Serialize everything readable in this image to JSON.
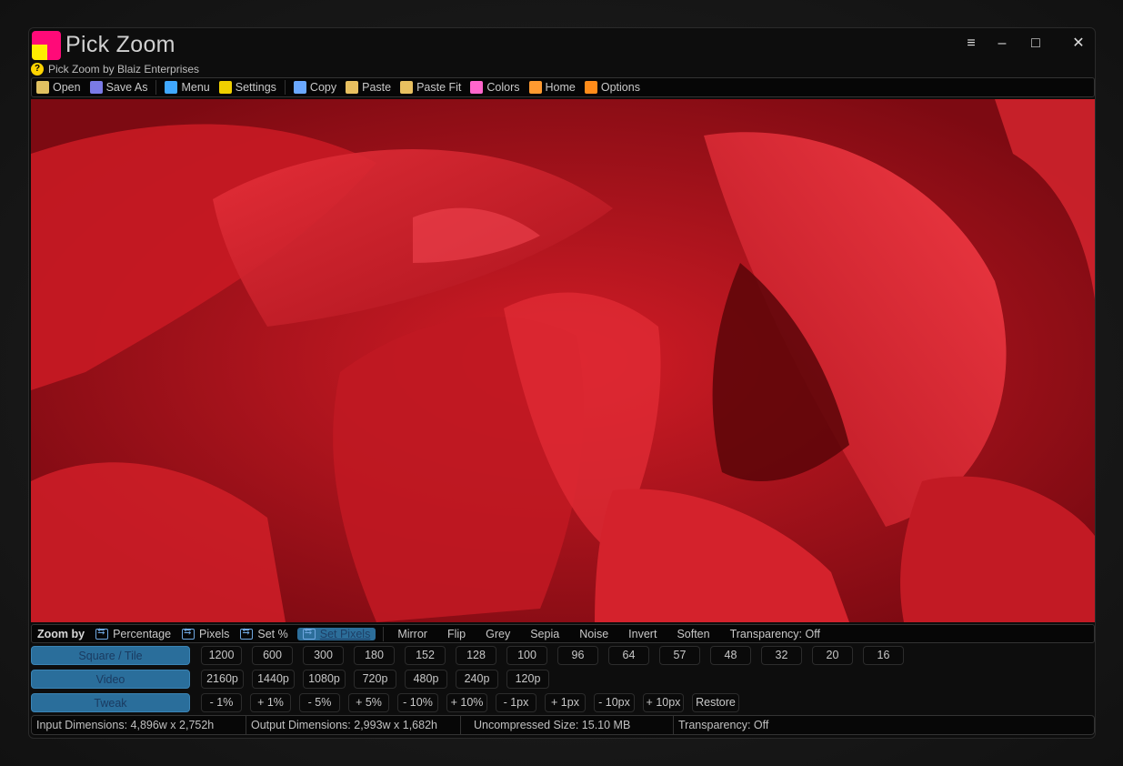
{
  "window": {
    "title": "Pick Zoom",
    "subtitle": "Pick Zoom by Blaiz Enterprises",
    "controls": [
      "≡",
      "–",
      "□",
      "✕"
    ]
  },
  "toolbar": [
    {
      "name": "open",
      "label": "Open",
      "icon": "folder-open-icon",
      "color": "#e0c060"
    },
    {
      "name": "save-as",
      "label": "Save As",
      "icon": "floppy-icon",
      "color": "#7a7ae6"
    },
    {
      "name": "menu",
      "label": "Menu",
      "icon": "menu-icon",
      "color": "#40a8ff"
    },
    {
      "name": "settings",
      "label": "Settings",
      "icon": "gear-icon",
      "color": "#f0d000"
    },
    {
      "name": "copy",
      "label": "Copy",
      "icon": "copy-icon",
      "color": "#6aa8ff"
    },
    {
      "name": "paste",
      "label": "Paste",
      "icon": "paste-icon",
      "color": "#e8c060"
    },
    {
      "name": "paste-fit",
      "label": "Paste Fit",
      "icon": "paste-fit-icon",
      "color": "#e8c060"
    },
    {
      "name": "colors",
      "label": "Colors",
      "icon": "palette-icon",
      "color": "#ff66cc"
    },
    {
      "name": "home",
      "label": "Home",
      "icon": "home-icon",
      "color": "#ff9a30"
    },
    {
      "name": "options",
      "label": "Options",
      "icon": "options-icon",
      "color": "#ff8c1a"
    }
  ],
  "zoom_by": {
    "label": "Zoom by",
    "modes": [
      {
        "label": "Percentage",
        "active": false
      },
      {
        "label": "Pixels",
        "active": false
      },
      {
        "label": "Set %",
        "active": false
      },
      {
        "label": "Set Pixels",
        "active": true
      }
    ],
    "effects": [
      "Mirror",
      "Flip",
      "Grey",
      "Sepia",
      "Noise",
      "Invert",
      "Soften",
      "Transparency: Off"
    ]
  },
  "rows": [
    {
      "name": "square-tile",
      "label": "Square / Tile",
      "buttons": [
        "1200",
        "600",
        "300",
        "180",
        "152",
        "128",
        "100",
        "96",
        "64",
        "57",
        "48",
        "32",
        "20",
        "16"
      ]
    },
    {
      "name": "video",
      "label": "Video",
      "buttons": [
        "2160p",
        "1440p",
        "1080p",
        "720p",
        "480p",
        "240p",
        "120p"
      ]
    },
    {
      "name": "tweak",
      "label": "Tweak",
      "buttons": [
        "- 1%",
        "+ 1%",
        "- 5%",
        "+ 5%",
        "- 10%",
        "+ 10%",
        "- 1px",
        "+ 1px",
        "- 10px",
        "+ 10px",
        "Restore"
      ]
    }
  ],
  "status": {
    "input": "Input Dimensions: 4,896w x 2,752h",
    "output": "Output Dimensions: 2,993w x 1,682h",
    "size": "Uncompressed Size: 15.10 MB",
    "transparency": "Transparency: Off"
  }
}
